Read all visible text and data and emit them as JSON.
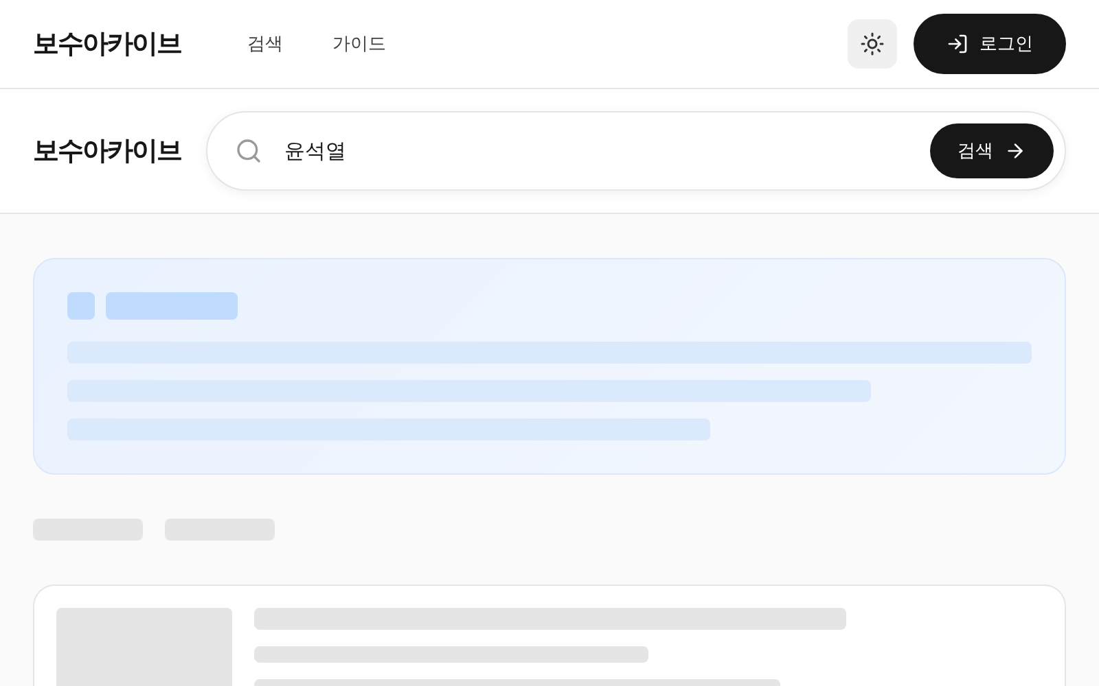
{
  "header": {
    "logo": "보수아카이브",
    "nav": [
      {
        "label": "검색"
      },
      {
        "label": "가이드"
      }
    ],
    "login_button": "로그인"
  },
  "search_bar": {
    "title": "보수아카이브",
    "query": {
      "value": "윤석열"
    },
    "button": "검색"
  }
}
